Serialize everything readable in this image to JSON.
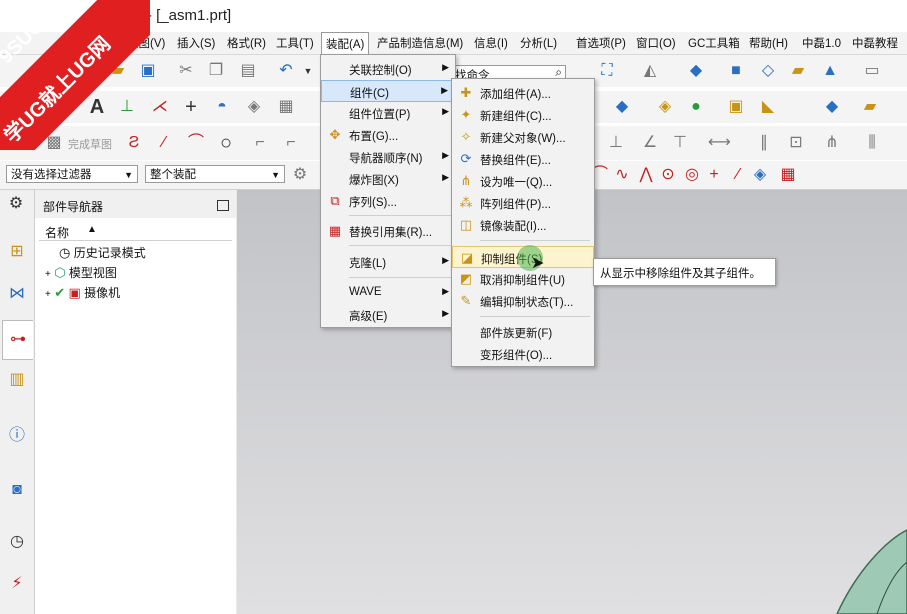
{
  "window": {
    "title": "- [_asm1.prt]"
  },
  "watermark": {
    "line1": "9SUG",
    "line2": "学UG就上UG网"
  },
  "menubar": {
    "items": [
      "视图(V)",
      "插入(S)",
      "格式(R)",
      "工具(T)",
      "装配(A)",
      "产品制造信息(M)",
      "信息(I)",
      "分析(L)",
      "首选项(P)",
      "窗口(O)",
      "GC工具箱",
      "帮助(H)",
      "中磊1.0",
      "中磊教程"
    ],
    "active": "装配(A)"
  },
  "toolbar": {
    "search_command": "找命令",
    "sketch_label": "完成草图"
  },
  "filterbar": {
    "selection_filter": "没有选择过滤器",
    "assembly_scope": "整个装配"
  },
  "navigator": {
    "title": "部件导航器",
    "column_name": "名称",
    "nodes": [
      "历史记录模式",
      "模型视图",
      "摄像机"
    ]
  },
  "assembly_menu": {
    "items": [
      "关联控制(O)",
      "组件(C)",
      "组件位置(P)",
      "布置(G)...",
      "导航器顺序(N)",
      "爆炸图(X)",
      "序列(S)...",
      "替换引用集(R)...",
      "克隆(L)",
      "WAVE",
      "高级(E)"
    ]
  },
  "component_menu": {
    "items": [
      "添加组件(A)...",
      "新建组件(C)...",
      "新建父对象(W)...",
      "替换组件(E)...",
      "设为唯一(Q)...",
      "阵列组件(P)...",
      "镜像装配(I)...",
      "抑制组件(S)",
      "取消抑制组件(U)",
      "编辑抑制状态(T)...",
      "部件族更新(F)",
      "变形组件(O)..."
    ],
    "highlighted": "抑制组件(S)"
  },
  "tooltip": {
    "text": "从显示中移除组件及其子组件。"
  },
  "colors": {
    "highlight": "#d6e8fa",
    "watermark": "#e02020",
    "graphics_bg": "#c8c9cc"
  }
}
